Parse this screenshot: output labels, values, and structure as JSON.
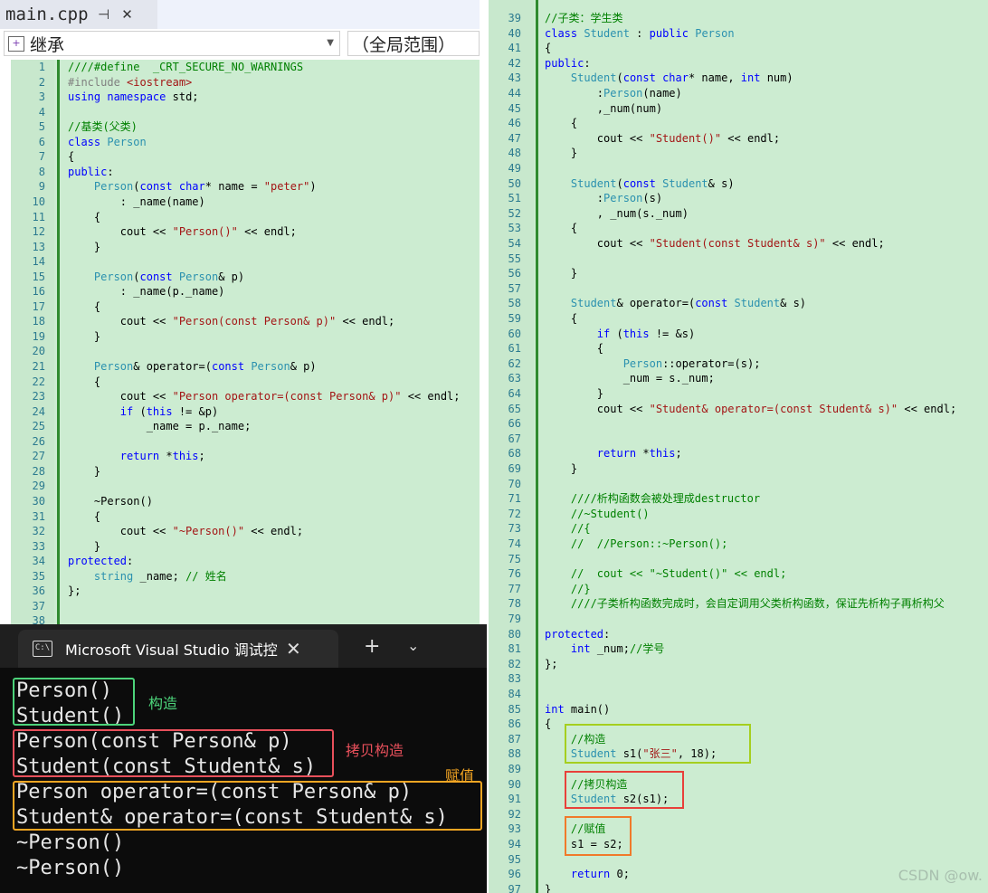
{
  "tab": {
    "title": "main.cpp",
    "pin": "⊣",
    "close": "✕"
  },
  "nav": {
    "scope": "继承",
    "member": "（全局范围）"
  },
  "left_code": {
    "lines": [
      {
        "n": "1",
        "text": "////#define  _CRT_SECURE_NO_WARNINGS",
        "kind": "c"
      },
      {
        "n": "2",
        "text": "#include <iostream>",
        "kind": "pp"
      },
      {
        "n": "3",
        "text": "using namespace std;",
        "kind": "code"
      },
      {
        "n": "4",
        "text": "",
        "kind": "code"
      },
      {
        "n": "5",
        "text": "//基类(父类)",
        "kind": "c"
      },
      {
        "n": "6",
        "text": "class Person",
        "kind": "code"
      },
      {
        "n": "7",
        "text": "{",
        "kind": "code"
      },
      {
        "n": "8",
        "text": "public:",
        "kind": "code"
      },
      {
        "n": "9",
        "text": "    Person(const char* name = \"peter\")",
        "kind": "code"
      },
      {
        "n": "10",
        "text": "        : _name(name)",
        "kind": "code"
      },
      {
        "n": "11",
        "text": "    {",
        "kind": "code"
      },
      {
        "n": "12",
        "text": "        cout << \"Person()\" << endl;",
        "kind": "code"
      },
      {
        "n": "13",
        "text": "    }",
        "kind": "code"
      },
      {
        "n": "14",
        "text": "",
        "kind": "code"
      },
      {
        "n": "15",
        "text": "    Person(const Person& p)",
        "kind": "code"
      },
      {
        "n": "16",
        "text": "        : _name(p._name)",
        "kind": "code"
      },
      {
        "n": "17",
        "text": "    {",
        "kind": "code"
      },
      {
        "n": "18",
        "text": "        cout << \"Person(const Person& p)\" << endl;",
        "kind": "code"
      },
      {
        "n": "19",
        "text": "    }",
        "kind": "code"
      },
      {
        "n": "20",
        "text": "",
        "kind": "code"
      },
      {
        "n": "21",
        "text": "    Person& operator=(const Person& p)",
        "kind": "code"
      },
      {
        "n": "22",
        "text": "    {",
        "kind": "code"
      },
      {
        "n": "23",
        "text": "        cout << \"Person operator=(const Person& p)\" << endl;",
        "kind": "code"
      },
      {
        "n": "24",
        "text": "        if (this != &p)",
        "kind": "code"
      },
      {
        "n": "25",
        "text": "            _name = p._name;",
        "kind": "code"
      },
      {
        "n": "26",
        "text": "",
        "kind": "code"
      },
      {
        "n": "27",
        "text": "        return *this;",
        "kind": "code"
      },
      {
        "n": "28",
        "text": "    }",
        "kind": "code"
      },
      {
        "n": "29",
        "text": "",
        "kind": "code"
      },
      {
        "n": "30",
        "text": "    ~Person()",
        "kind": "code"
      },
      {
        "n": "31",
        "text": "    {",
        "kind": "code"
      },
      {
        "n": "32",
        "text": "        cout << \"~Person()\" << endl;",
        "kind": "code"
      },
      {
        "n": "33",
        "text": "    }",
        "kind": "code"
      },
      {
        "n": "34",
        "text": "protected:",
        "kind": "code"
      },
      {
        "n": "35",
        "text": "    string _name; // 姓名",
        "kind": "code"
      },
      {
        "n": "36",
        "text": "};",
        "kind": "code"
      },
      {
        "n": "37",
        "text": "",
        "kind": "code"
      },
      {
        "n": "38",
        "text": "",
        "kind": "code"
      }
    ]
  },
  "right_code": {
    "lines": [
      {
        "n": "39",
        "text": "//子类：学生类"
      },
      {
        "n": "40",
        "text": "class Student : public Person"
      },
      {
        "n": "41",
        "text": "{"
      },
      {
        "n": "42",
        "text": "public:"
      },
      {
        "n": "43",
        "text": "    Student(const char* name, int num)"
      },
      {
        "n": "44",
        "text": "        :Person(name)"
      },
      {
        "n": "45",
        "text": "        ,_num(num)"
      },
      {
        "n": "46",
        "text": "    {"
      },
      {
        "n": "47",
        "text": "        cout << \"Student()\" << endl;"
      },
      {
        "n": "48",
        "text": "    }"
      },
      {
        "n": "49",
        "text": ""
      },
      {
        "n": "50",
        "text": "    Student(const Student& s)"
      },
      {
        "n": "51",
        "text": "        :Person(s)"
      },
      {
        "n": "52",
        "text": "        , _num(s._num)"
      },
      {
        "n": "53",
        "text": "    {"
      },
      {
        "n": "54",
        "text": "        cout << \"Student(const Student& s)\" << endl;"
      },
      {
        "n": "55",
        "text": ""
      },
      {
        "n": "56",
        "text": "    }"
      },
      {
        "n": "57",
        "text": ""
      },
      {
        "n": "58",
        "text": "    Student& operator=(const Student& s)"
      },
      {
        "n": "59",
        "text": "    {"
      },
      {
        "n": "60",
        "text": "        if (this != &s)"
      },
      {
        "n": "61",
        "text": "        {"
      },
      {
        "n": "62",
        "text": "            Person::operator=(s);"
      },
      {
        "n": "63",
        "text": "            _num = s._num;"
      },
      {
        "n": "64",
        "text": "        }"
      },
      {
        "n": "65",
        "text": "        cout << \"Student& operator=(const Student& s)\" << endl;"
      },
      {
        "n": "66",
        "text": ""
      },
      {
        "n": "67",
        "text": ""
      },
      {
        "n": "68",
        "text": "        return *this;"
      },
      {
        "n": "69",
        "text": "    }"
      },
      {
        "n": "70",
        "text": ""
      },
      {
        "n": "71",
        "text": "    ////析构函数会被处理成destructor"
      },
      {
        "n": "72",
        "text": "    //~Student()"
      },
      {
        "n": "73",
        "text": "    //{"
      },
      {
        "n": "74",
        "text": "    //  //Person::~Person();"
      },
      {
        "n": "75",
        "text": ""
      },
      {
        "n": "76",
        "text": "    //  cout << \"~Student()\" << endl;"
      },
      {
        "n": "77",
        "text": "    //}"
      },
      {
        "n": "78",
        "text": "    ////子类析构函数完成时，会自定调用父类析构函数，保证先析构子再析构父"
      },
      {
        "n": "79",
        "text": ""
      },
      {
        "n": "80",
        "text": "protected:"
      },
      {
        "n": "81",
        "text": "    int _num;//学号"
      },
      {
        "n": "82",
        "text": "};"
      },
      {
        "n": "83",
        "text": ""
      },
      {
        "n": "84",
        "text": ""
      },
      {
        "n": "85",
        "text": "int main()"
      },
      {
        "n": "86",
        "text": "{"
      },
      {
        "n": "87",
        "text": "    //构造"
      },
      {
        "n": "88",
        "text": "    Student s1(\"张三\", 18);"
      },
      {
        "n": "89",
        "text": ""
      },
      {
        "n": "90",
        "text": "    //拷贝构造"
      },
      {
        "n": "91",
        "text": "    Student s2(s1);"
      },
      {
        "n": "92",
        "text": ""
      },
      {
        "n": "93",
        "text": "    //赋值"
      },
      {
        "n": "94",
        "text": "    s1 = s2;"
      },
      {
        "n": "95",
        "text": ""
      },
      {
        "n": "96",
        "text": "    return 0;"
      },
      {
        "n": "97",
        "text": "}"
      }
    ]
  },
  "terminal": {
    "title": "Microsoft Visual Studio 调试控",
    "close": "✕",
    "new_tab": "+",
    "dropdown": "⌄",
    "icon": "C:\\",
    "output": [
      "Person()",
      "Student()",
      "Person(const Person& p)",
      "Student(const Student& s)",
      "Person operator=(const Person& p)",
      "Student& operator=(const Student& s)",
      "~Person()",
      "~Person()"
    ],
    "notes": {
      "construct": "构造",
      "copy": "拷贝构造",
      "assign": "赋值"
    }
  },
  "colors": {
    "construct": "#4cd37a",
    "copy": "#e8505b",
    "assign": "#f5a623",
    "right_construct": "#a5cf1f",
    "right_copy": "#e8403a",
    "right_assign": "#f07a2a"
  },
  "watermark": "CSDN @ow."
}
